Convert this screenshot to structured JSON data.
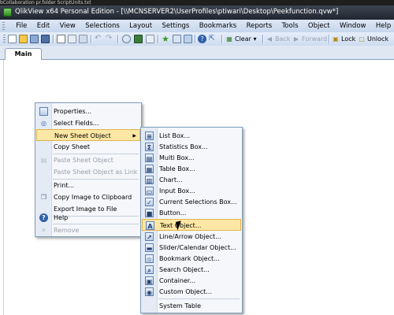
{
  "window": {
    "top_strip_text": "bCollaboration  pr.folder  ScriptUnits.txt",
    "title": "QlikView x64 Personal Edition - [\\\\MCNSERVER2\\UserProfiles\\ptiwari\\Desktop\\Peekfunction.qvw*]"
  },
  "menubar": {
    "items": [
      "File",
      "Edit",
      "View",
      "Selections",
      "Layout",
      "Settings",
      "Bookmarks",
      "Reports",
      "Tools",
      "Object",
      "Window",
      "Help"
    ]
  },
  "toolbar": {
    "clear": "Clear",
    "clear_dropdown": "▾",
    "back": "Back",
    "forward": "Forward",
    "lock": "Lock",
    "unlock": "Unlock"
  },
  "tabs": [
    "Main"
  ],
  "context_menu": {
    "properties": "Properties...",
    "select_fields": "Select Fields...",
    "new_sheet_object": "New Sheet Object",
    "copy_sheet": "Copy Sheet",
    "paste_sheet_object": "Paste Sheet Object",
    "paste_as_link": "Paste Sheet Object as Link",
    "print": "Print...",
    "copy_image": "Copy Image to Clipboard",
    "export_image": "Export Image to File",
    "help": "Help",
    "remove": "Remove"
  },
  "submenu": {
    "list_box": "List Box...",
    "statistics_box": "Statistics Box...",
    "multi_box": "Multi Box...",
    "table_box": "Table Box...",
    "chart": "Chart...",
    "input_box": "Input Box...",
    "current_selections_box": "Current Selections Box...",
    "button": "Button...",
    "text_object": "Text Object...",
    "line_arrow_object": "Line/Arrow Object...",
    "slider_calendar_object": "Slider/Calendar Object...",
    "bookmark_object": "Bookmark Object...",
    "search_object": "Search Object...",
    "container": "Container...",
    "custom_object": "Custom Object...",
    "system_table": "System Table"
  },
  "colors": {
    "highlight": "#fde7a4",
    "highlight_border": "#e2b34c",
    "menu_border": "#7f9db9"
  }
}
